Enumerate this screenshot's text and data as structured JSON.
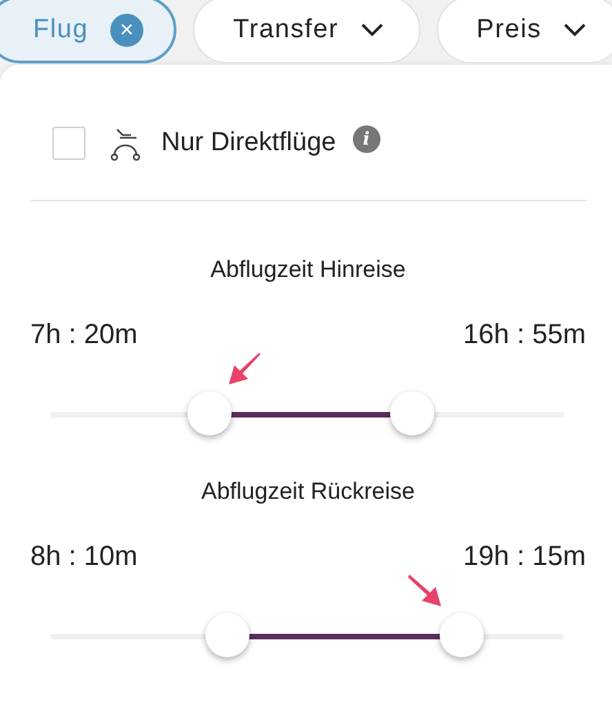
{
  "filter_chips": [
    {
      "label": "Flug",
      "kind": "removable",
      "selected": true,
      "remove_symbol": "✕"
    },
    {
      "label": "Transfer",
      "kind": "dropdown",
      "selected": false
    },
    {
      "label": "Preis",
      "kind": "dropdown",
      "selected": false
    }
  ],
  "direct_only": {
    "label": "Nur Direktflüge",
    "checked": false,
    "info_symbol": "i"
  },
  "sliders": [
    {
      "title": "Abflugzeit Hinreise",
      "min_reading": "7h : 20m",
      "max_reading": "16h : 55m",
      "thumbs": [
        {
          "level": 0.31,
          "pointed_at": true
        },
        {
          "level": 0.705,
          "pointed_at": false
        }
      ]
    },
    {
      "title": "Abflugzeit Rückreise",
      "min_reading": "8h : 10m",
      "max_reading": "19h : 15m",
      "thumbs": [
        {
          "level": 0.343,
          "pointed_at": false
        },
        {
          "level": 0.8,
          "pointed_at": true
        }
      ]
    }
  ]
}
